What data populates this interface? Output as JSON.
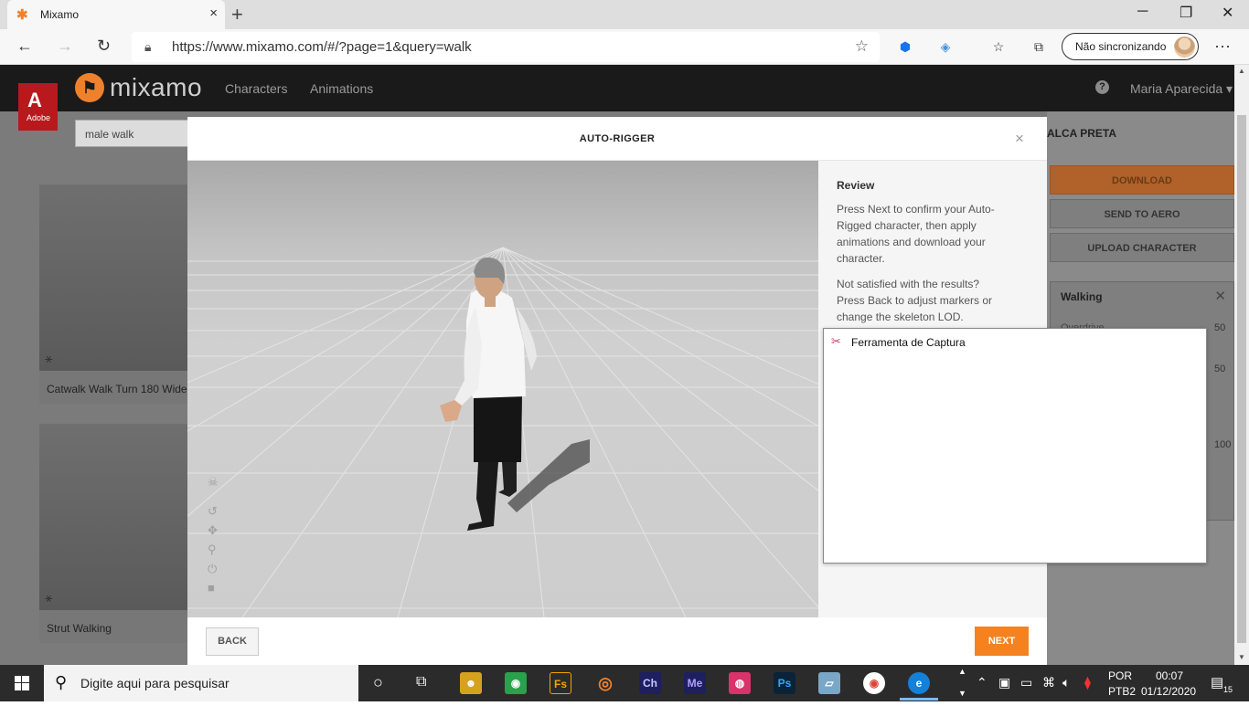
{
  "browser": {
    "tab_title": "Mixamo",
    "tab_close": "×",
    "new_tab": "+",
    "url": "https://www.mixamo.com/#/?page=1&query=walk",
    "sync_label": "Não sincronizando",
    "minimize": "─",
    "restore": "❐",
    "close": "✕",
    "menu": "···"
  },
  "mixamo": {
    "adobe_label": "Adobe",
    "brand": "mixamo",
    "nav": [
      "Characters",
      "Animations"
    ],
    "help": "?",
    "user": "Maria Aparecida",
    "search_value": "male walk",
    "cards": [
      {
        "label": "Catwalk Walk Turn 180 Wide"
      },
      {
        "label": "Strut Walking"
      }
    ],
    "right_title": "ALCA PRETA",
    "buttons": [
      "DOWNLOAD",
      "SEND TO AERO",
      "UPLOAD CHARACTER"
    ],
    "anim_name": "Walking",
    "anim_param": "Overdrive",
    "numbers": [
      "50",
      "50",
      "100"
    ]
  },
  "modal": {
    "title": "AUTO-RIGGER",
    "close": "×",
    "review_heading": "Review",
    "p1": "Press Next to confirm your Auto-Rigged character, then apply animations and download your character.",
    "p2": "Not satisfied with the results? Press Back to adjust markers or change the skeleton LOD.",
    "back": "BACK",
    "next": "NEXT"
  },
  "snip_popup": {
    "title": "Ferramenta de Captura"
  },
  "taskbar": {
    "search_placeholder": "Digite aqui para pesquisar",
    "lang1": "POR",
    "lang2": "PTB2",
    "time": "00:07",
    "date": "01/12/2020",
    "notif_count": "15"
  },
  "colors": {
    "accent": "#f5821f",
    "mixamo_dark": "#1a1a1a",
    "adobe_red": "#b8191d"
  }
}
